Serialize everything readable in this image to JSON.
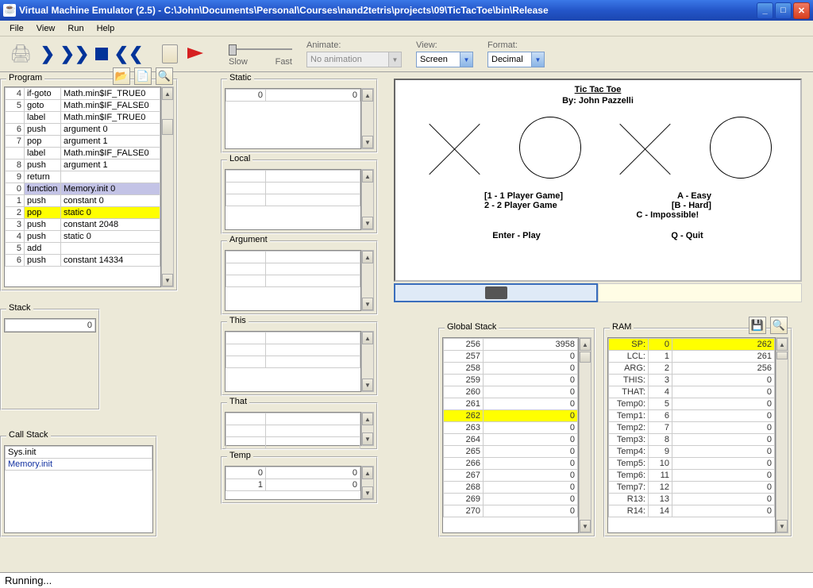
{
  "title": "Virtual Machine Emulator (2.5) - C:\\John\\Documents\\Personal\\Courses\\nand2tetris\\projects\\09\\TicTacToe\\bin\\Release",
  "menu": [
    "File",
    "View",
    "Run",
    "Help"
  ],
  "toolbar": {
    "slow": "Slow",
    "fast": "Fast",
    "animate_lbl": "Animate:",
    "animate_val": "No animation",
    "view_lbl": "View:",
    "view_val": "Screen",
    "format_lbl": "Format:",
    "format_val": "Decimal"
  },
  "panels": {
    "program": "Program",
    "static": "Static",
    "local": "Local",
    "argument": "Argument",
    "this": "This",
    "that": "That",
    "temp": "Temp",
    "stack": "Stack",
    "callstack": "Call Stack",
    "global_stack": "Global Stack",
    "ram": "RAM"
  },
  "program_rows": [
    {
      "n": "4",
      "a": "if-goto",
      "b": "Math.min$IF_TRUE0"
    },
    {
      "n": "5",
      "a": "goto",
      "b": "Math.min$IF_FALSE0"
    },
    {
      "n": "",
      "a": "label",
      "b": "Math.min$IF_TRUE0"
    },
    {
      "n": "6",
      "a": "push",
      "b": "argument 0"
    },
    {
      "n": "7",
      "a": "pop",
      "b": "argument 1"
    },
    {
      "n": "",
      "a": "label",
      "b": "Math.min$IF_FALSE0"
    },
    {
      "n": "8",
      "a": "push",
      "b": "argument 1"
    },
    {
      "n": "9",
      "a": "return",
      "b": ""
    },
    {
      "n": "0",
      "a": "function",
      "b": "Memory.init 0",
      "sel": true
    },
    {
      "n": "1",
      "a": "push",
      "b": "constant 0"
    },
    {
      "n": "2",
      "a": "pop",
      "b": "static 0",
      "hi": true
    },
    {
      "n": "3",
      "a": "push",
      "b": "constant 2048"
    },
    {
      "n": "4",
      "a": "push",
      "b": "static 0"
    },
    {
      "n": "5",
      "a": "add",
      "b": ""
    },
    {
      "n": "6",
      "a": "push",
      "b": "constant 14334"
    }
  ],
  "static_rows": [
    {
      "a": "0",
      "v": "0"
    }
  ],
  "temp_rows": [
    {
      "a": "0",
      "v": "0"
    },
    {
      "a": "1",
      "v": "0"
    }
  ],
  "stack_val": "0",
  "callstack": [
    "Sys.init",
    "Memory.init"
  ],
  "global_stack": [
    {
      "a": "256",
      "v": "3958"
    },
    {
      "a": "257",
      "v": "0"
    },
    {
      "a": "258",
      "v": "0"
    },
    {
      "a": "259",
      "v": "0"
    },
    {
      "a": "260",
      "v": "0"
    },
    {
      "a": "261",
      "v": "0"
    },
    {
      "a": "262",
      "v": "0",
      "hi": true
    },
    {
      "a": "263",
      "v": "0"
    },
    {
      "a": "264",
      "v": "0"
    },
    {
      "a": "265",
      "v": "0"
    },
    {
      "a": "266",
      "v": "0"
    },
    {
      "a": "267",
      "v": "0"
    },
    {
      "a": "268",
      "v": "0"
    },
    {
      "a": "269",
      "v": "0"
    },
    {
      "a": "270",
      "v": "0"
    }
  ],
  "ram": [
    {
      "l": "SP:",
      "a": "0",
      "v": "262",
      "hi": true
    },
    {
      "l": "LCL:",
      "a": "1",
      "v": "261"
    },
    {
      "l": "ARG:",
      "a": "2",
      "v": "256"
    },
    {
      "l": "THIS:",
      "a": "3",
      "v": "0"
    },
    {
      "l": "THAT:",
      "a": "4",
      "v": "0"
    },
    {
      "l": "Temp0:",
      "a": "5",
      "v": "0"
    },
    {
      "l": "Temp1:",
      "a": "6",
      "v": "0"
    },
    {
      "l": "Temp2:",
      "a": "7",
      "v": "0"
    },
    {
      "l": "Temp3:",
      "a": "8",
      "v": "0"
    },
    {
      "l": "Temp4:",
      "a": "9",
      "v": "0"
    },
    {
      "l": "Temp5:",
      "a": "10",
      "v": "0"
    },
    {
      "l": "Temp6:",
      "a": "11",
      "v": "0"
    },
    {
      "l": "Temp7:",
      "a": "12",
      "v": "0"
    },
    {
      "l": "R13:",
      "a": "13",
      "v": "0"
    },
    {
      "l": "R14:",
      "a": "14",
      "v": "0"
    }
  ],
  "screen": {
    "title": "Tic Tac Toe",
    "by": "By: John Pazzelli",
    "opt1a": "[1 - 1 Player Game]",
    "opt1b": "A - Easy",
    "opt2a": " 2 - 2 Player Game ",
    "opt2b": "[B - Hard]",
    "opt3b": "C - Impossible!",
    "play": "Enter - Play",
    "quit": "Q - Quit"
  },
  "status": "Running..."
}
